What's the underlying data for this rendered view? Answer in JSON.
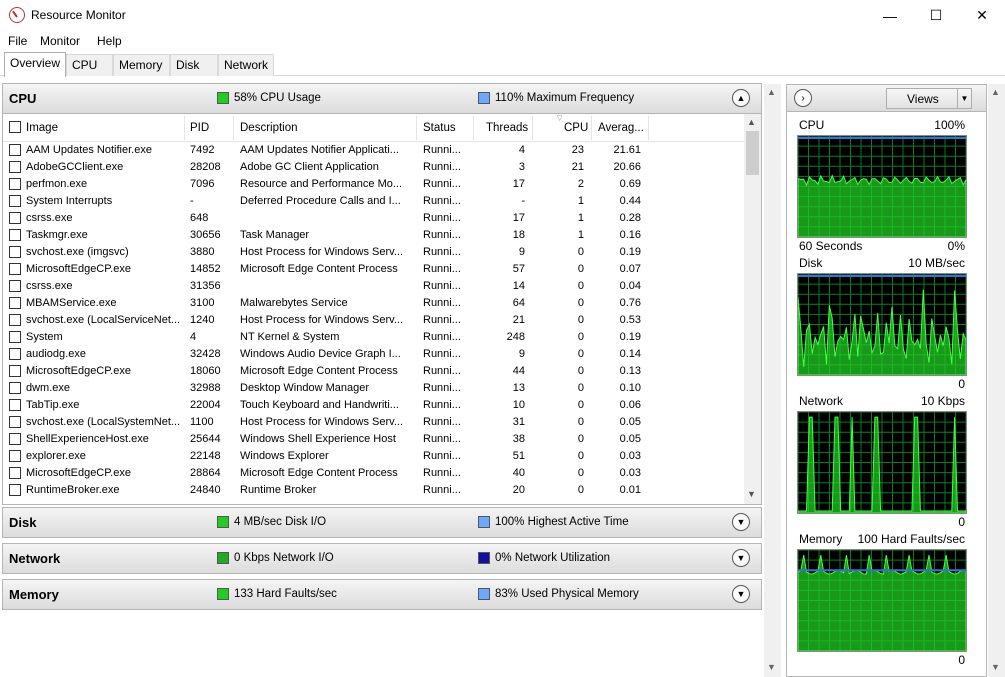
{
  "window": {
    "title": "Resource Monitor",
    "minimize": "—",
    "maximize": "☐",
    "close": "✕"
  },
  "menu": [
    "File",
    "Monitor",
    "Help"
  ],
  "tabs": [
    "Overview",
    "CPU",
    "Memory",
    "Disk",
    "Network"
  ],
  "cpu": {
    "title": "CPU",
    "legend1": "58% CPU Usage",
    "legend1_color": "#22cc22",
    "legend2": "110% Maximum Frequency",
    "legend2_color": "#6fa8ff",
    "columns": [
      "Image",
      "PID",
      "Description",
      "Status",
      "Threads",
      "CPU",
      "Averag..."
    ],
    "rows": [
      {
        "image": "AAM Updates Notifier.exe",
        "pid": "7492",
        "desc": "AAM Updates Notifier Applicati...",
        "status": "Runni...",
        "threads": "4",
        "cpu": "23",
        "avg": "21.61"
      },
      {
        "image": "AdobeGCClient.exe",
        "pid": "28208",
        "desc": "Adobe GC Client Application",
        "status": "Runni...",
        "threads": "3",
        "cpu": "21",
        "avg": "20.66"
      },
      {
        "image": "perfmon.exe",
        "pid": "7096",
        "desc": "Resource and Performance Mo...",
        "status": "Runni...",
        "threads": "17",
        "cpu": "2",
        "avg": "0.69"
      },
      {
        "image": "System Interrupts",
        "pid": "-",
        "desc": "Deferred Procedure Calls and I...",
        "status": "Runni...",
        "threads": "-",
        "cpu": "1",
        "avg": "0.44"
      },
      {
        "image": "csrss.exe",
        "pid": "648",
        "desc": "",
        "status": "Runni...",
        "threads": "17",
        "cpu": "1",
        "avg": "0.28"
      },
      {
        "image": "Taskmgr.exe",
        "pid": "30656",
        "desc": "Task Manager",
        "status": "Runni...",
        "threads": "18",
        "cpu": "1",
        "avg": "0.16"
      },
      {
        "image": "svchost.exe (imgsvc)",
        "pid": "3880",
        "desc": "Host Process for Windows Serv...",
        "status": "Runni...",
        "threads": "9",
        "cpu": "0",
        "avg": "0.19"
      },
      {
        "image": "MicrosoftEdgeCP.exe",
        "pid": "14852",
        "desc": "Microsoft Edge Content Process",
        "status": "Runni...",
        "threads": "57",
        "cpu": "0",
        "avg": "0.07"
      },
      {
        "image": "csrss.exe",
        "pid": "31356",
        "desc": "",
        "status": "Runni...",
        "threads": "14",
        "cpu": "0",
        "avg": "0.04"
      },
      {
        "image": "MBAMService.exe",
        "pid": "3100",
        "desc": "Malwarebytes Service",
        "status": "Runni...",
        "threads": "64",
        "cpu": "0",
        "avg": "0.76"
      },
      {
        "image": "svchost.exe (LocalServiceNet...",
        "pid": "1240",
        "desc": "Host Process for Windows Serv...",
        "status": "Runni...",
        "threads": "21",
        "cpu": "0",
        "avg": "0.53"
      },
      {
        "image": "System",
        "pid": "4",
        "desc": "NT Kernel & System",
        "status": "Runni...",
        "threads": "248",
        "cpu": "0",
        "avg": "0.19"
      },
      {
        "image": "audiodg.exe",
        "pid": "32428",
        "desc": "Windows Audio Device Graph I...",
        "status": "Runni...",
        "threads": "9",
        "cpu": "0",
        "avg": "0.14"
      },
      {
        "image": "MicrosoftEdgeCP.exe",
        "pid": "18060",
        "desc": "Microsoft Edge Content Process",
        "status": "Runni...",
        "threads": "44",
        "cpu": "0",
        "avg": "0.13"
      },
      {
        "image": "dwm.exe",
        "pid": "32988",
        "desc": "Desktop Window Manager",
        "status": "Runni...",
        "threads": "13",
        "cpu": "0",
        "avg": "0.10"
      },
      {
        "image": "TabTip.exe",
        "pid": "22004",
        "desc": "Touch Keyboard and Handwriti...",
        "status": "Runni...",
        "threads": "10",
        "cpu": "0",
        "avg": "0.06"
      },
      {
        "image": "svchost.exe (LocalSystemNet...",
        "pid": "1100",
        "desc": "Host Process for Windows Serv...",
        "status": "Runni...",
        "threads": "31",
        "cpu": "0",
        "avg": "0.05"
      },
      {
        "image": "ShellExperienceHost.exe",
        "pid": "25644",
        "desc": "Windows Shell Experience Host",
        "status": "Runni...",
        "threads": "38",
        "cpu": "0",
        "avg": "0.05"
      },
      {
        "image": "explorer.exe",
        "pid": "22148",
        "desc": "Windows Explorer",
        "status": "Runni...",
        "threads": "51",
        "cpu": "0",
        "avg": "0.03"
      },
      {
        "image": "MicrosoftEdgeCP.exe",
        "pid": "28864",
        "desc": "Microsoft Edge Content Process",
        "status": "Runni...",
        "threads": "40",
        "cpu": "0",
        "avg": "0.03"
      },
      {
        "image": "RuntimeBroker.exe",
        "pid": "24840",
        "desc": "Runtime Broker",
        "status": "Runni...",
        "threads": "20",
        "cpu": "0",
        "avg": "0.01"
      }
    ]
  },
  "disk": {
    "title": "Disk",
    "legend1": "4 MB/sec Disk I/O",
    "legend1_color": "#22cc22",
    "legend2": "100% Highest Active Time",
    "legend2_color": "#6fa8ff"
  },
  "network": {
    "title": "Network",
    "legend1": "0 Kbps Network I/O",
    "legend1_color": "#22aa22",
    "legend2": "0% Network Utilization",
    "legend2_color": "#1010a0"
  },
  "memory": {
    "title": "Memory",
    "legend1": "133 Hard Faults/sec",
    "legend1_color": "#22cc22",
    "legend2": "83% Used Physical Memory",
    "legend2_color": "#6fa8ff"
  },
  "views": {
    "label": "Views"
  },
  "graphs": {
    "cpu": {
      "label": "CPU",
      "max": "100%",
      "bottom_left": "60 Seconds",
      "bottom_right": "0%"
    },
    "disk": {
      "label": "Disk",
      "max": "10 MB/sec",
      "bottom_right": "0"
    },
    "network": {
      "label": "Network",
      "max": "10 Kbps",
      "bottom_right": "0"
    },
    "memory": {
      "label": "Memory",
      "max": "100 Hard Faults/sec",
      "bottom_right": "0"
    }
  }
}
